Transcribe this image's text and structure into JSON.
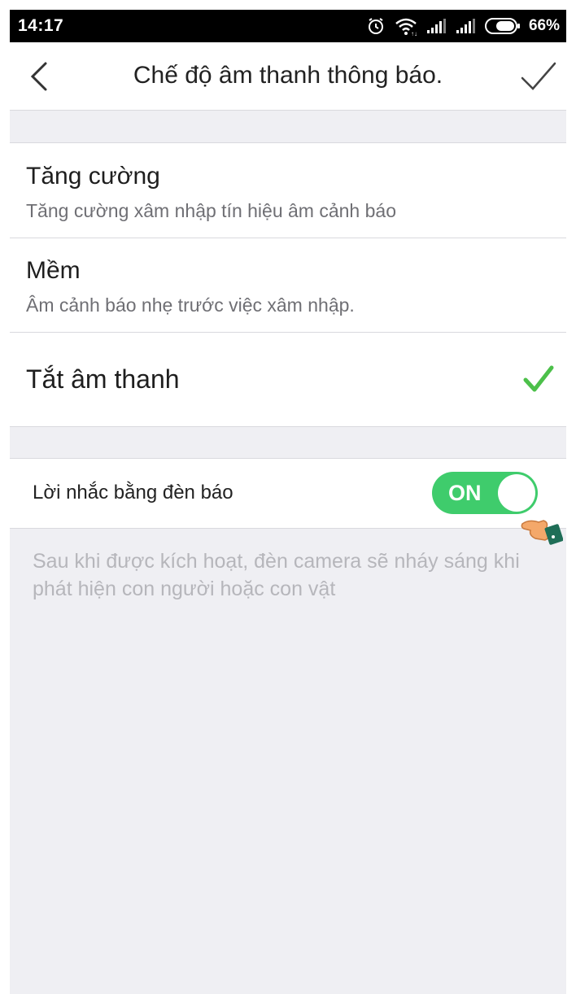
{
  "status_bar": {
    "time": "14:17",
    "battery": "66%",
    "icons": [
      "alarm-icon",
      "wifi-icon",
      "signal-icon",
      "signal-icon",
      "battery-icon"
    ]
  },
  "header": {
    "title": "Chế độ âm thanh thông báo.",
    "back_icon": "chevron-left-icon",
    "confirm_icon": "check-icon"
  },
  "options": [
    {
      "title": "Tăng cường",
      "description": "Tăng cường xâm nhập tín hiệu âm cảnh báo",
      "selected": false
    },
    {
      "title": "Mềm",
      "description": "Âm cảnh báo nhẹ trước việc xâm nhập.",
      "selected": false
    },
    {
      "title": "Tắt âm thanh",
      "selected": true
    }
  ],
  "toggle": {
    "label": "Lời nhắc bằng đèn báo",
    "state_text": "ON",
    "on": true
  },
  "hint": "Sau khi được kích hoạt, đèn camera sẽ nháy sáng khi phát hiện con người hoặc con vật",
  "colors": {
    "accent_green": "#3fcc6c",
    "check_green": "#4cc04a",
    "background": "#efeff3"
  }
}
